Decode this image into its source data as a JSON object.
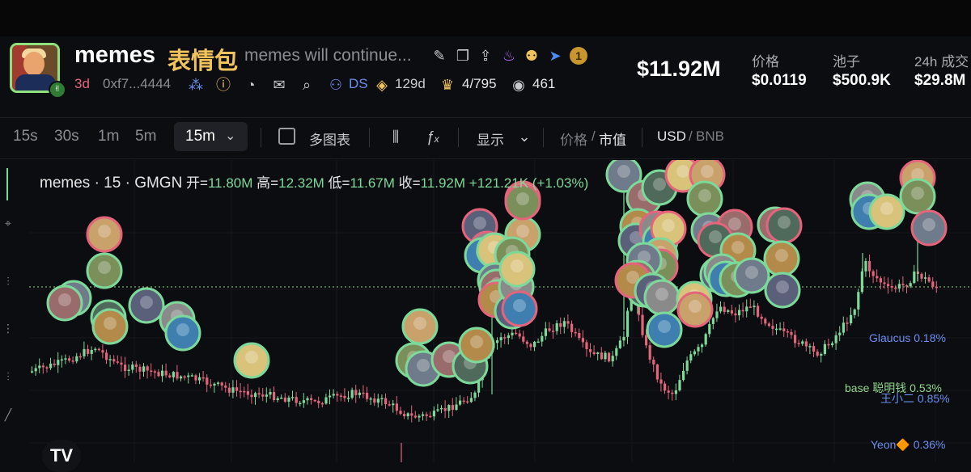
{
  "token": {
    "name": "memes",
    "name_cn": "表情包",
    "description": "memes will continue...",
    "age": "3d",
    "address": "0xf7...4444",
    "ds_label": "DS",
    "days_label": "129d",
    "holders_ratio": "4/795",
    "watchers": "461",
    "badge_number": "1"
  },
  "stats": {
    "market_cap": "$11.92M",
    "price_label": "价格",
    "price_value": "$0.0119",
    "pool_label": "池子",
    "pool_value": "$500.9K",
    "volume_label": "24h 成交",
    "volume_value": "$29.8M"
  },
  "toolbar": {
    "timeframes": [
      "15s",
      "30s",
      "1m",
      "5m"
    ],
    "active_timeframe": "15m",
    "multi_chart_label": "多图表",
    "display_label": "显示",
    "price_label": "价格",
    "mcap_label": "市值",
    "usd_label": "USD",
    "bnb_label": "BNB"
  },
  "ohlc": {
    "title": "memes · 15 · GMGN",
    "open_label": "开=",
    "open": "11.80M",
    "high_label": "高=",
    "high": "12.32M",
    "low_label": "低=",
    "low": "11.67M",
    "close_label": "收=",
    "close": "11.92M",
    "change": "+121.21K (+1.03%)"
  },
  "top_traders": [
    {
      "name": "Glaucus",
      "pct": "0.18%",
      "color": "#6b8ff0"
    },
    {
      "name": "base 聪明钱",
      "pct": "0.53%",
      "color": "#8fd68c"
    },
    {
      "name": "王小二",
      "pct": "0.85%",
      "color": "#6b8ff0"
    },
    {
      "name": "Yeon🔶",
      "pct": "0.36%",
      "color": "#6b8ff0"
    }
  ],
  "logo_text": "TV",
  "colors": {
    "up": "#7dd99a",
    "down": "#e4647c",
    "accent_yellow": "#f0c35c",
    "accent_blue": "#6b8ff0"
  },
  "chart_data": {
    "type": "candlestick",
    "title": "memes · 15 · GMGN",
    "interval": "15m",
    "unit": "market cap (USD)",
    "last_close": "11.92M",
    "grid": true
  }
}
